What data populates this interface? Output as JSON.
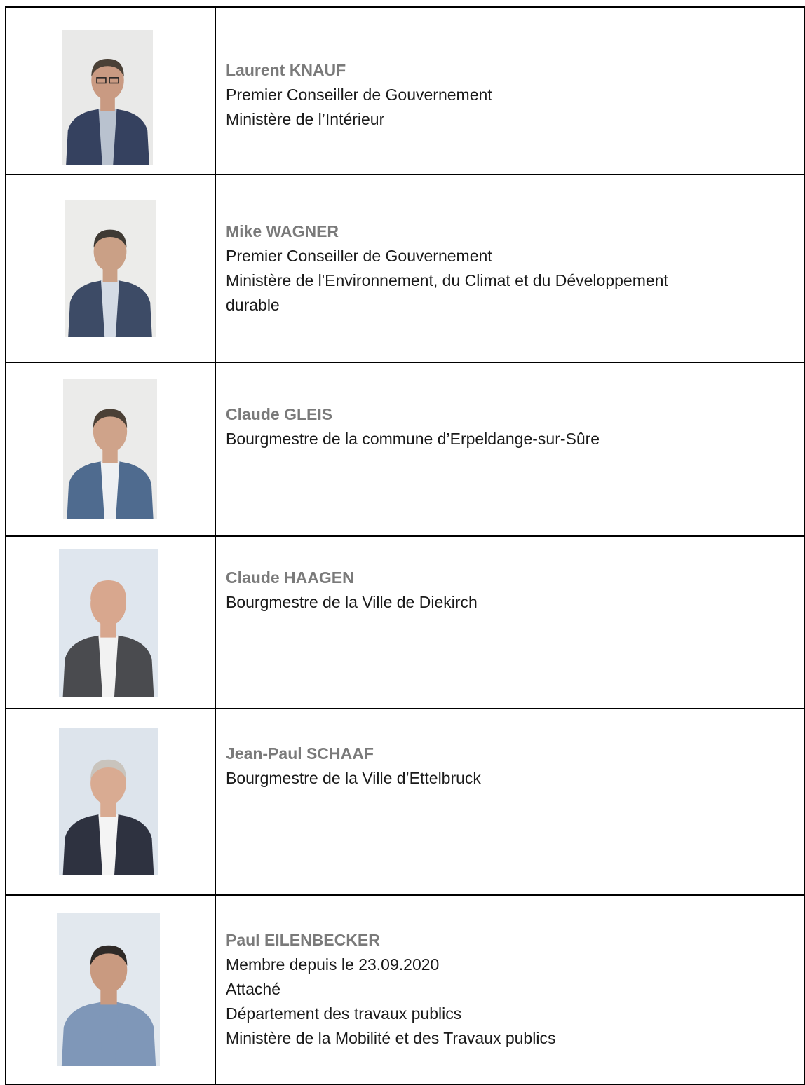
{
  "members": [
    {
      "name": "Laurent KNAUF",
      "lines": [
        "Premier Conseiller de Gouvernement",
        "Ministère de l’Intérieur"
      ],
      "photo": {
        "bg": "#e9e9e8",
        "suit": "#35415f",
        "shirt": "#b9c2cf",
        "skin": "#c99a82",
        "hair": "#4a4036",
        "glasses": true
      }
    },
    {
      "name": "Mike WAGNER",
      "lines": [
        "Premier Conseiller de Gouvernement",
        "Ministère de l'Environnement, du Climat et du Développement",
        "durable"
      ],
      "photo": {
        "bg": "#ececea",
        "suit": "#3d4b66",
        "shirt": "#d4dbe5",
        "skin": "#caa086",
        "hair": "#3f3a34",
        "glasses": false
      }
    },
    {
      "name": "Claude GLEIS",
      "lines": [
        "Bourgmestre de la commune d’Erpeldange-sur-Sûre"
      ],
      "photo": {
        "bg": "#ebebea",
        "suit": "#4f6b8f",
        "shirt": "#eef0f3",
        "skin": "#cfa38a",
        "hair": "#4b4036",
        "glasses": false
      }
    },
    {
      "name": "Claude HAAGEN",
      "lines": [
        "Bourgmestre de la Ville de Diekirch"
      ],
      "photo": {
        "bg": "#dfe6ee",
        "suit": "#4a4b4f",
        "shirt": "#f2f2f2",
        "skin": "#d8a78e",
        "hair": "#d8a78e",
        "glasses": false
      }
    },
    {
      "name": "Jean-Paul SCHAAF",
      "lines": [
        "Bourgmestre de la Ville d’Ettelbruck"
      ],
      "photo": {
        "bg": "#dde4ec",
        "suit": "#2e3240",
        "shirt": "#f4f4f4",
        "skin": "#d9ab92",
        "hair": "#c9c4bd",
        "glasses": false
      }
    },
    {
      "name": "Paul EILENBECKER",
      "lines": [
        "Membre depuis le 23.09.2020",
        "Attaché",
        "Département des travaux publics",
        "Ministère de la Mobilité et des Travaux publics"
      ],
      "photo": {
        "bg": "#e2e8ee",
        "suit": "#7f97b8",
        "shirt": "#7f97b8",
        "skin": "#c99a80",
        "hair": "#2f2a27",
        "glasses": false
      }
    }
  ]
}
